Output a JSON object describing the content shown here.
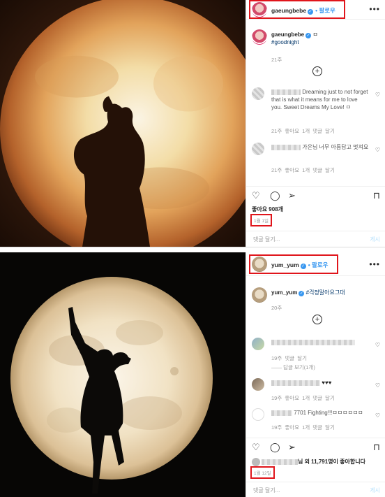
{
  "post1": {
    "username": "gaeungbebe",
    "follow_label": "• 팔로우",
    "more_label": "•••",
    "caption_username": "gaeungbebe",
    "caption_text": "ㅁ",
    "hashtag": "#goodnight",
    "caption_time": "21주",
    "comments": [
      {
        "text": "Dreaming just to not forget that is what it means for me to love you. Sweet Dreams My Love! ㅁ",
        "meta": "21주  좋아요 1개  댓글 달기"
      },
      {
        "text": "가은님 너무 아름답고 멋져요",
        "meta": "21주  좋아요 1개  댓글 달기"
      }
    ],
    "likes": "좋아요 908개",
    "date": "1월 1일",
    "add_comment": "댓글 달기...",
    "post_label": "게시"
  },
  "post2": {
    "username": "yum_yum",
    "follow_label": "• 팔로우",
    "more_label": "•••",
    "caption_username": "yum_yum",
    "hashtag": "#걱정말아요그대",
    "caption_time": "20주",
    "comments": [
      {
        "text": "",
        "meta": "19주  댓글 달기",
        "replies": "—— 답글 보기(1개)"
      },
      {
        "text": "♥♥♥",
        "meta": "19주  좋아요 1개  댓글 달기"
      },
      {
        "text": "7701 Fighting!!!ㅁㅁㅁㅁㅁㅁ",
        "meta": "19주  좋아요 1개  댓글 달기"
      }
    ],
    "likes_suffix": "님 외 11,791명이 좋아합니다",
    "date": "1월 12일",
    "add_comment": "댓글 달기...",
    "post_label": "게시"
  },
  "icons": {
    "heart": "heart-icon",
    "comment": "comment-icon",
    "share": "share-icon",
    "save": "bookmark-icon",
    "add": "plus-circle-icon",
    "verified": "verified-badge-icon"
  },
  "colors": {
    "accent": "#3897f0",
    "highlight": "#e0151b",
    "hashtag": "#003569",
    "muted": "#999999"
  }
}
